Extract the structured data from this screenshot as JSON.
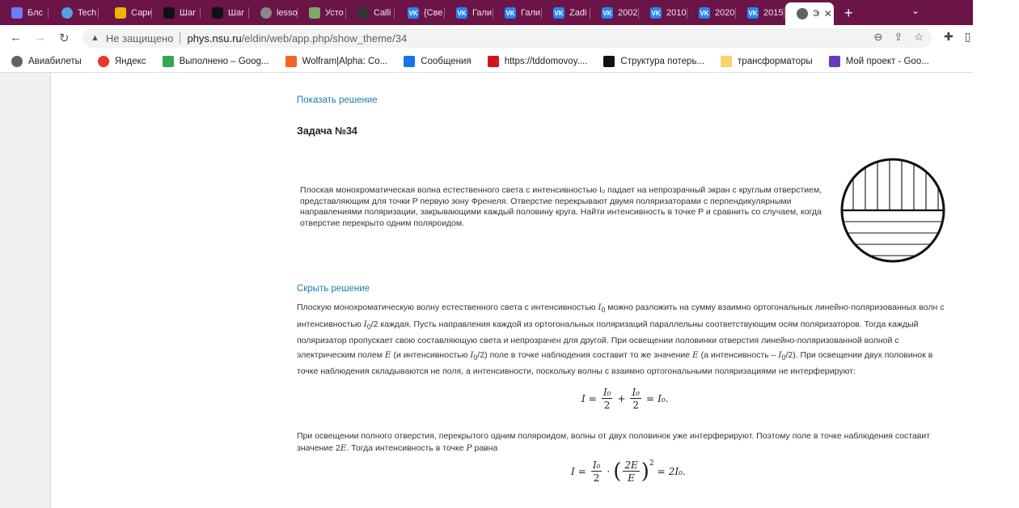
{
  "tabs": [
    {
      "title": "Блс",
      "icon": "triangle-logo-icon",
      "color": "#6c7cff"
    },
    {
      "title": "Tech",
      "icon": "globe-blue-icon",
      "color": "#4fa3e0"
    },
    {
      "title": "Сари",
      "icon": "yellow-app-icon",
      "color": "#f0b400"
    },
    {
      "title": "Шаг",
      "icon": "black-diamond-icon",
      "color": "#111111"
    },
    {
      "title": "Шаг",
      "icon": "black-diamond-icon",
      "color": "#111111"
    },
    {
      "title": "lesso",
      "icon": "globe-icon",
      "color": "#888888"
    },
    {
      "title": "Усто",
      "icon": "leaf-icon",
      "color": "#7ea86a"
    },
    {
      "title": "Calli",
      "icon": "dark-circle-icon",
      "color": "#333333"
    },
    {
      "title": "{Све",
      "icon": "vk-icon",
      "color": "#2787f5"
    },
    {
      "title": "Гали",
      "icon": "vk-icon",
      "color": "#2787f5"
    },
    {
      "title": "Гали",
      "icon": "vk-icon",
      "color": "#2787f5"
    },
    {
      "title": "Zadi",
      "icon": "vk-icon",
      "color": "#2787f5"
    },
    {
      "title": "2002",
      "icon": "vk-icon",
      "color": "#2787f5"
    },
    {
      "title": "2010",
      "icon": "vk-icon",
      "color": "#2787f5"
    },
    {
      "title": "2020",
      "icon": "vk-icon",
      "color": "#2787f5"
    },
    {
      "title": "2015",
      "icon": "vk-icon",
      "color": "#2787f5"
    },
    {
      "title": "Э",
      "icon": "globe-icon",
      "color": "#5f6368",
      "active": true
    }
  ],
  "tab_close": "✕",
  "new_tab": "+",
  "address": {
    "not_secure": "Не защищено",
    "host": "phys.nsu.ru",
    "path": "/eldin/web/app.php/show_theme/34"
  },
  "bookmarks": [
    {
      "label": "Авиабилеты",
      "icon": "globe-icon",
      "color": "#5f6368"
    },
    {
      "label": "Яндекс",
      "icon": "yandex-icon",
      "color": "#e8362c"
    },
    {
      "label": "Выполнено – Goog...",
      "icon": "google-drive-icon",
      "color": "#34a853"
    },
    {
      "label": "Wolfram|Alpha: Co...",
      "icon": "wolfram-icon",
      "color": "#f26522"
    },
    {
      "label": "Сообщения",
      "icon": "messages-icon",
      "color": "#1a73e8"
    },
    {
      "label": "https://tddomovoy....",
      "icon": "red-a-icon",
      "color": "#d4141c"
    },
    {
      "label": "Структура потерь...",
      "icon": "bolt-icon",
      "color": "#111111"
    },
    {
      "label": "трансформаторы",
      "icon": "folder-icon",
      "color": "#f6d36b"
    },
    {
      "label": "Мой проект - Goo...",
      "icon": "forms-icon",
      "color": "#673ab7"
    }
  ],
  "page": {
    "show_solution": "Показать решение",
    "task_title": "Задача №34",
    "problem": "Плоская монохроматическая волна естественного света с интенсивностью I₀ падает на непрозрачный экран с круглым отверстием, представляющим для точки P первую зону Френеля. Отверстие перекрывают двумя поляризаторами с перпендикулярными направлениями поляризации, закрывающими каждый половину круга. Найти интенсивность в точке P и сравнить со случаем, когда отверстие перекрыто одним поляроидом.",
    "hide_solution": "Скрыть решение",
    "solution_html": "Плоскую монохроматическую волну естественного света с интенсивностью <i>I</i><sub>0</sub> можно разложить на сумму взаимно ортогональных линейно-поляризованных волн с интенсивностью <i>I</i><sub>0</sub>/2 каждая. Пусть направления каждой из ортогональных поляризаций параллельны соответствующим осям поляризаторов. Тогда каждый поляризатор пропускает свою составляющую света и непрозрачен для другой. При освещении половинки отверстия линейно-поляризованной волной с электрическим полем <i>E</i> (и интенсивностью <i>I</i><sub>0</sub>/2) поле в точке наблюдения составит то же значение <i>E</i> (а интенсивность – <i>I</i><sub>0</sub>/2). При освещении двух половинок в точке наблюдения складываются не поля, а интенсивности, поскольку волны с взаимно ортогональными поляризациями не интерферируют:",
    "formula1": {
      "lhs": "I",
      "n1": "I₀",
      "d1": "2",
      "n2": "I₀",
      "d2": "2",
      "rhs": "I₀."
    },
    "solution2_html": "При освещении полного отверстия, перекрытого одним поляроидом, волны от двух половинок уже интерферируют. Поэтому поле в точке наблюдения составит значение 2<i>E</i>. Тогда интенсивность в точке <i>P</i> равна",
    "formula2": {
      "lhs": "I",
      "n1": "I₀",
      "d1": "2",
      "n2": "2E",
      "d2": "E",
      "exp": "2",
      "rhs": "2I₀."
    }
  }
}
